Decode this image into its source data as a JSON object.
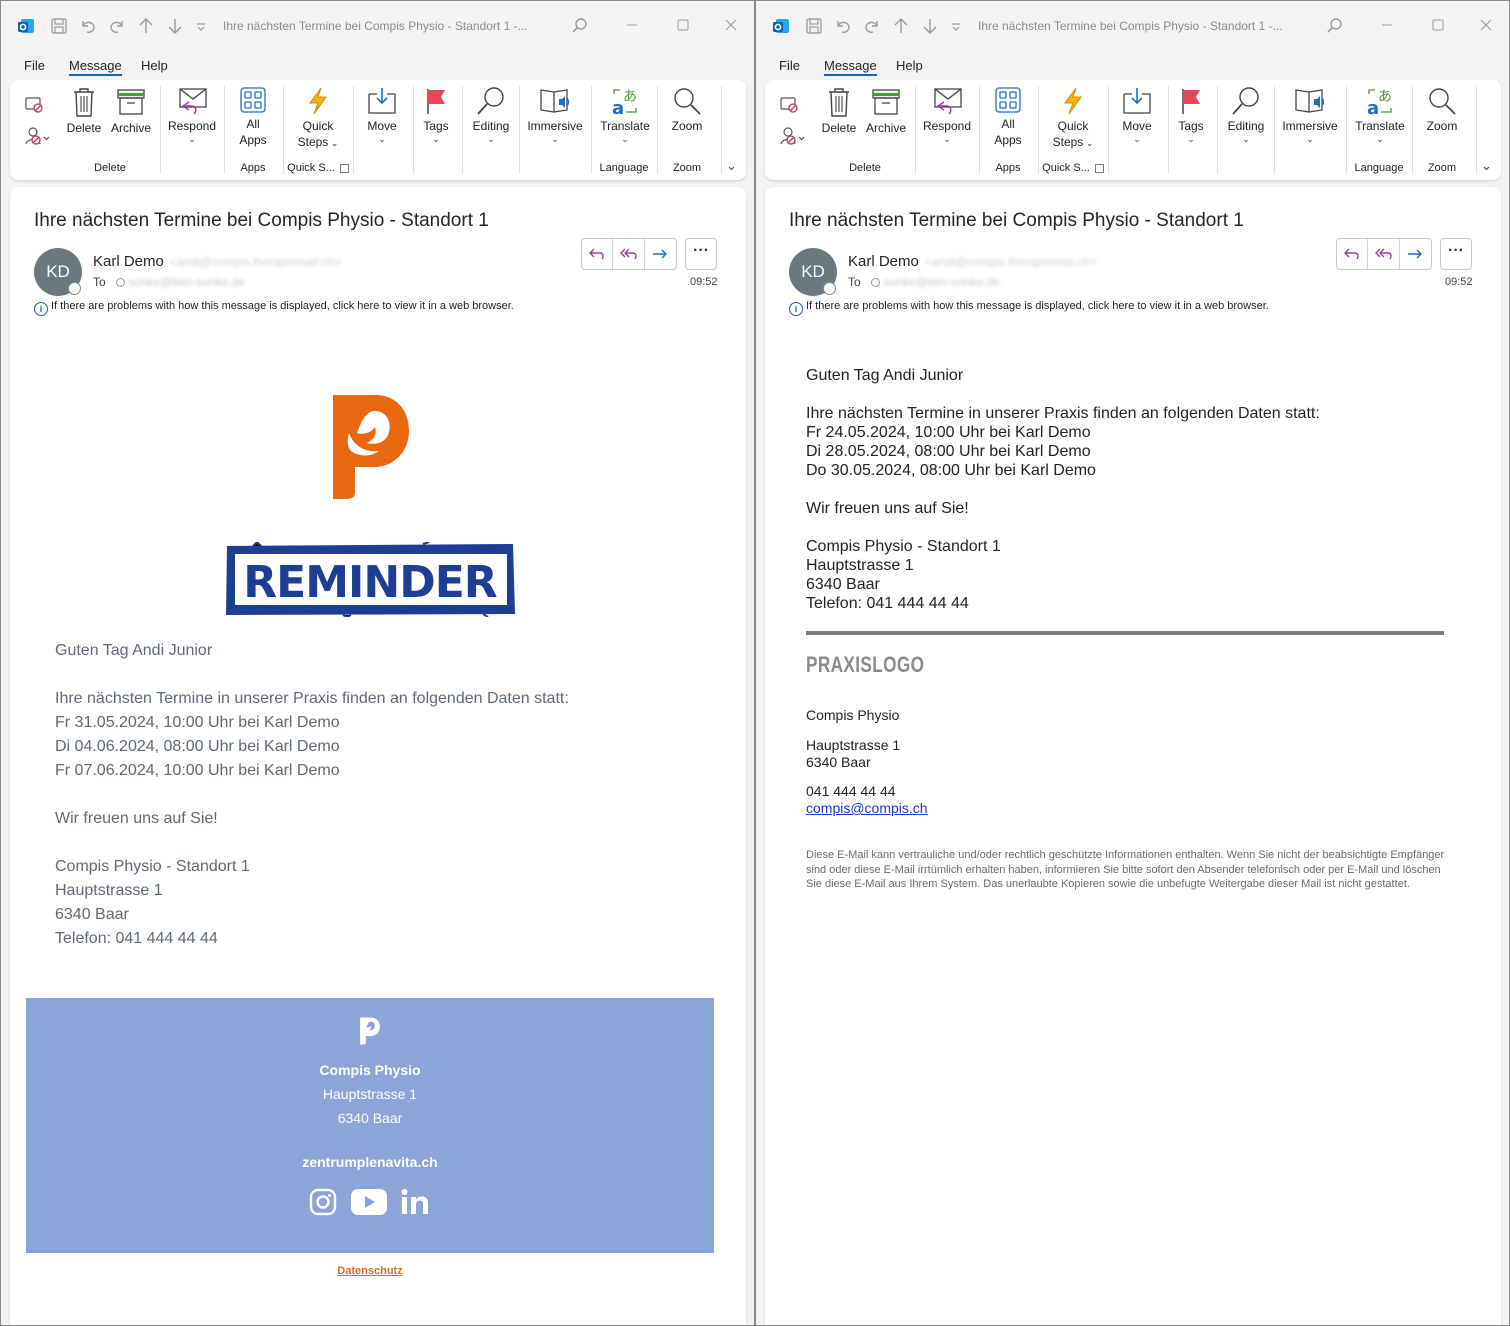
{
  "window_title": "Ihre nächsten Termine bei Compis Physio - Standort 1 -...",
  "menu": {
    "file": "File",
    "message": "Message",
    "help": "Help"
  },
  "ribbon": {
    "delete": "Delete",
    "archive": "Archive",
    "respond": "Respond",
    "all_apps_1": "All",
    "all_apps_2": "Apps",
    "quick_steps_1": "Quick",
    "quick_steps_2": "Steps",
    "move": "Move",
    "tags": "Tags",
    "editing": "Editing",
    "immersive": "Immersive",
    "translate": "Translate",
    "zoom": "Zoom",
    "groups": {
      "delete": "Delete",
      "apps": "Apps",
      "quick_steps": "Quick S...",
      "language": "Language",
      "zoom": "Zoom"
    }
  },
  "left": {
    "subject": "Ihre nächsten Termine bei Compis Physio - Standort 1",
    "avatar": "KD",
    "sender": "Karl Demo",
    "sender_email": "<andi@compis.therapiemail.ch>",
    "to_label": "To",
    "to_email": "sonke@bkn-sonke.de",
    "time": "09:52",
    "info": "If there are problems with how this message is displayed, click here to view it in a web browser.",
    "reminder": "REMINDER",
    "greeting": "Guten Tag Andi Junior",
    "intro": "Ihre nächsten Termine in unserer Praxis finden an folgenden Daten statt:",
    "appointments": [
      "Fr 31.05.2024, 10:00 Uhr bei Karl Demo",
      "Di 04.06.2024, 08:00 Uhr bei Karl Demo",
      "Fr 07.06.2024, 10:00 Uhr bei Karl Demo"
    ],
    "closing": "Wir freuen uns auf Sie!",
    "signature": [
      "Compis Physio - Standort 1",
      "Hauptstrasse 1",
      "6340 Baar",
      "Telefon: 041 444 44 44"
    ],
    "footer": {
      "name": "Compis Physio",
      "street": "Hauptstrasse 1",
      "city": "6340 Baar",
      "website": "zentrumplenavita.ch"
    },
    "privacy_link": "Datenschutz"
  },
  "right": {
    "subject": "Ihre nächsten Termine bei Compis Physio - Standort 1",
    "avatar": "KD",
    "sender": "Karl Demo",
    "sender_email": "<andi@compis.therapiemail.ch>",
    "to_label": "To",
    "to_email": "sonke@bkn-sonke.de",
    "time": "09:52",
    "info": "If there are problems with how this message is displayed, click here to view it in a web browser.",
    "greeting": "Guten Tag Andi Junior",
    "intro": "Ihre nächsten Termine in unserer Praxis finden an folgenden Daten statt:",
    "appointments": [
      "Fr 24.05.2024, 10:00 Uhr bei Karl Demo",
      "Di 28.05.2024, 08:00 Uhr bei Karl Demo",
      "Do 30.05.2024, 08:00 Uhr bei Karl Demo"
    ],
    "closing": "Wir freuen uns auf Sie!",
    "signature": [
      "Compis Physio - Standort 1",
      "Hauptstrasse 1",
      "6340 Baar",
      "Telefon: 041 444 44 44"
    ],
    "praxislogo": "PRAXISLOGO",
    "sig2": {
      "name": "Compis Physio",
      "street": "Hauptstrasse 1",
      "city": "6340 Baar",
      "phone": "041 444 44 44",
      "email": "compis@compis.ch"
    },
    "disclaimer": "Diese E-Mail kann vertrauliche und/oder rechtlich geschützte Informationen enthalten. Wenn Sie nicht der beabsichtigte Empfänger sind oder diese E-Mail irrtümlich erhalten haben, informieren Sie bitte sofort den Absender telefonisch oder per E-Mail und löschen Sie diese E-Mail aus Ihrem System. Das unerlaubte Kopieren sowie die unbefugte Weitergabe dieser Mail ist nicht gestattet."
  },
  "colors": {
    "accent": "#1d5fb0",
    "brand_orange": "#e8680f",
    "reminder_blue": "#1c3f94",
    "footer_bg": "#8ba6d6"
  }
}
